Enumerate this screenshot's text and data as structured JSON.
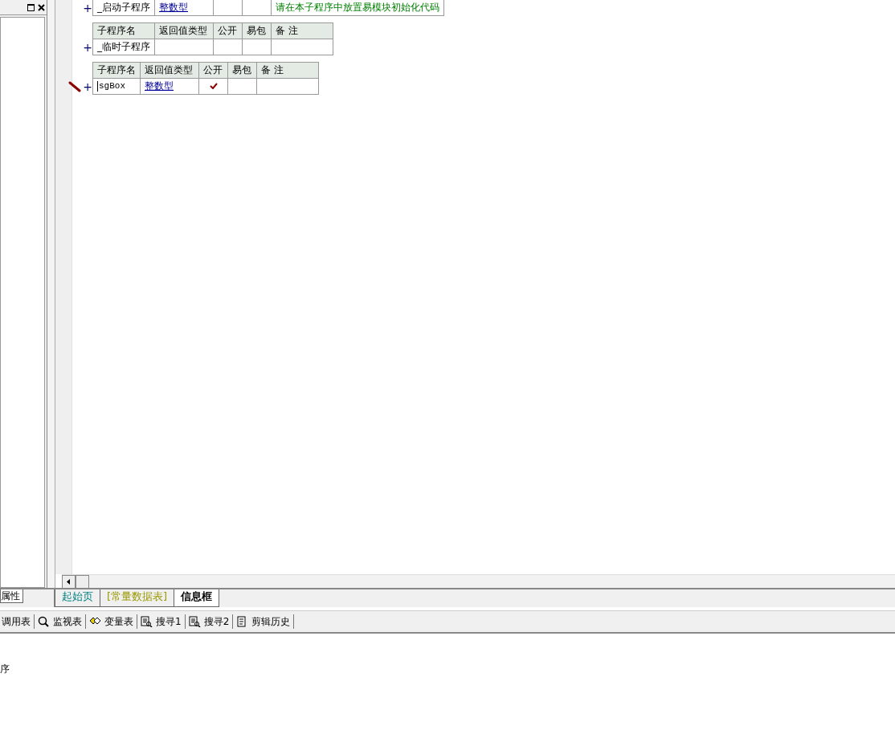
{
  "left_panel": {
    "tab": "属性"
  },
  "routines": [
    {
      "expander": "+",
      "editing": false,
      "row": {
        "name": "_启动子程序",
        "return_type": "整数型",
        "public": false,
        "remark": "请在本子程序中放置易模块初始化代码"
      }
    },
    {
      "expander": "+",
      "editing": false,
      "header": [
        "子程序名",
        "返回值类型",
        "公开",
        "易包",
        "备 注"
      ],
      "row": {
        "name": "_临时子程序",
        "public": false
      }
    },
    {
      "expander": "+",
      "editing": true,
      "header": [
        "子程序名",
        "返回值类型",
        "公开",
        "易包",
        "备 注"
      ],
      "row": {
        "name": "sgBox",
        "return_type": "整数型",
        "public": true
      }
    }
  ],
  "doc_tabs": [
    {
      "label": "起始页",
      "color": "#008080",
      "selected": false
    },
    {
      "label": "[常量数据表]",
      "color": "#999900",
      "selected": false
    },
    {
      "label": "信息框",
      "color": "#000000",
      "selected": true
    }
  ],
  "toolbar": [
    {
      "kind": "plain",
      "label": "调用表"
    },
    {
      "kind": "watch",
      "label": "监视表"
    },
    {
      "kind": "variables",
      "label": "变量表"
    },
    {
      "kind": "search",
      "label": "搜寻1"
    },
    {
      "kind": "search",
      "label": "搜寻2"
    },
    {
      "kind": "clipboard",
      "label": "剪辑历史"
    }
  ],
  "output": {
    "text": "序"
  }
}
